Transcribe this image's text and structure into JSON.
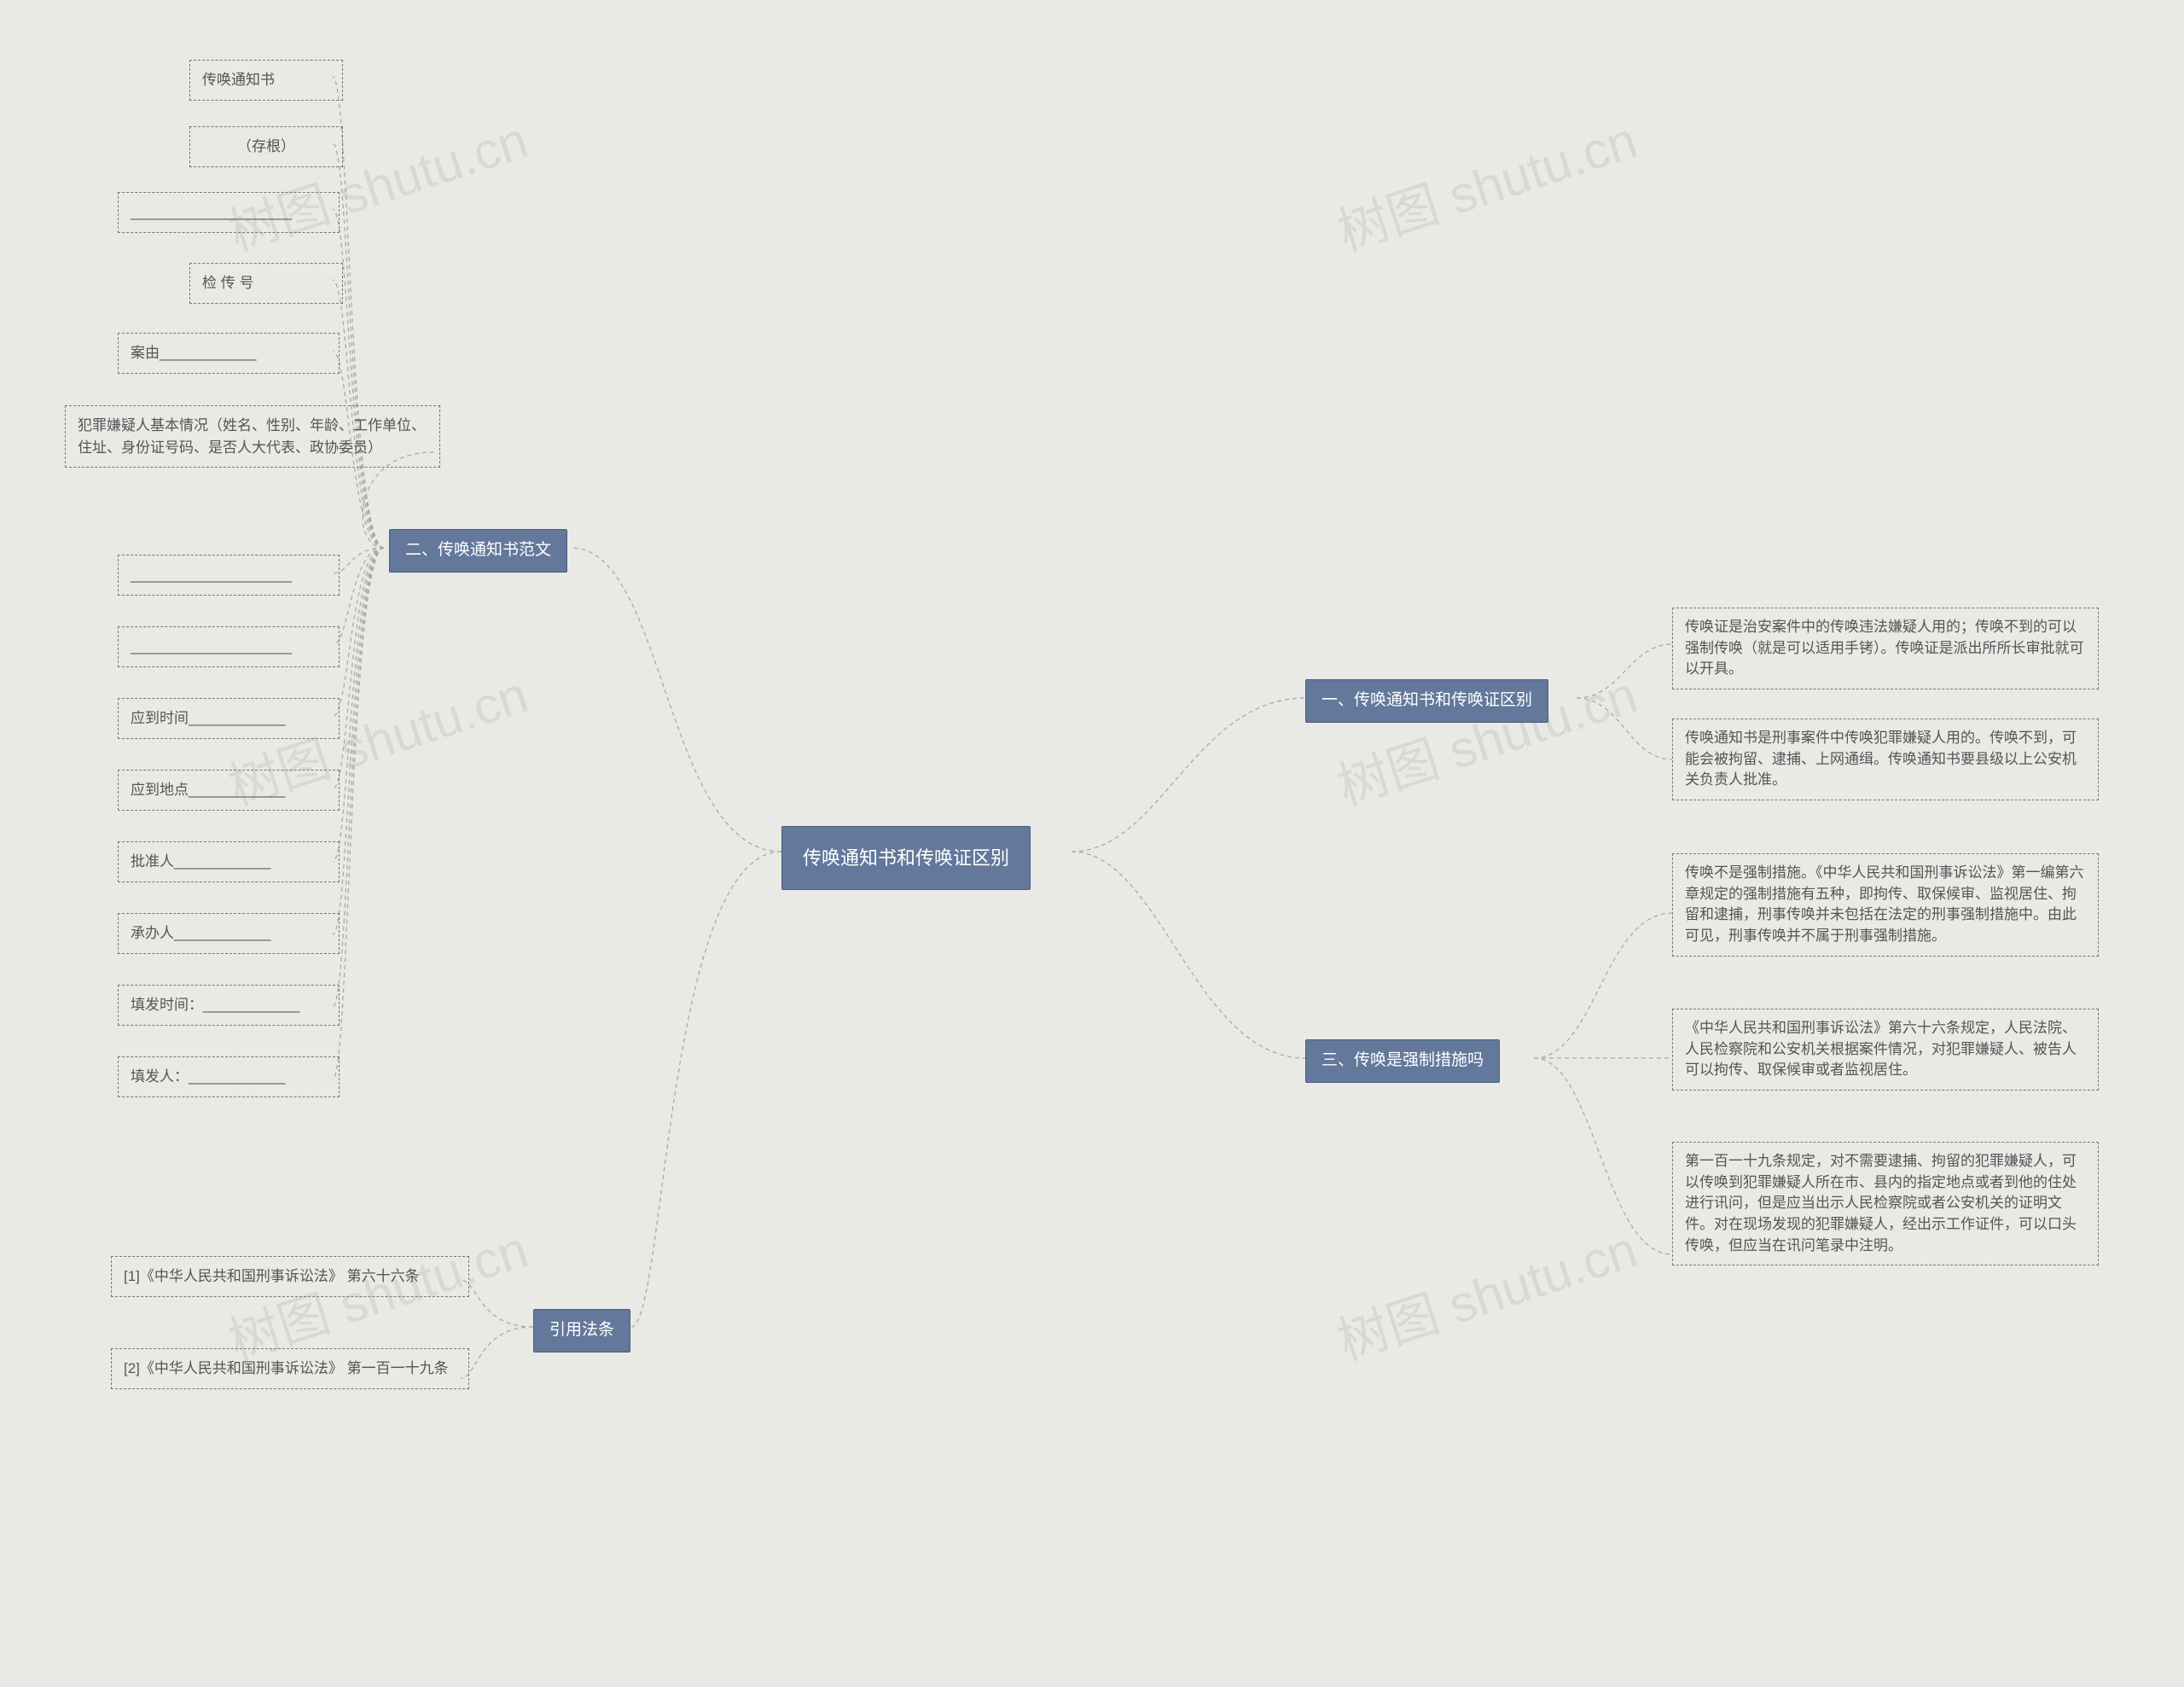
{
  "root": {
    "title": "传唤通知书和传唤证区别"
  },
  "branches": {
    "b1": {
      "title": "一、传唤通知书和传唤证区别",
      "children": {
        "c1": "传唤证是治安案件中的传唤违法嫌疑人用的；传唤不到的可以强制传唤（就是可以适用手铐）。传唤证是派出所所长审批就可以开具。",
        "c2": "传唤通知书是刑事案件中传唤犯罪嫌疑人用的。传唤不到，可能会被拘留、逮捕、上网通缉。传唤通知书要县级以上公安机关负责人批准。"
      }
    },
    "b2": {
      "title": "二、传唤通知书范文",
      "children": {
        "n1": "传唤通知书",
        "n2": "（存根）",
        "n3": "____________________",
        "n4": "检 传  号",
        "n5": "案由____________",
        "n6": "犯罪嫌疑人基本情况（姓名、性别、年龄、工作单位、住址、身份证号码、是否人大代表、政协委员）",
        "n7": "____________________",
        "n8": "____________________",
        "n9": "应到时间____________",
        "n10": "应到地点____________",
        "n11": "批准人____________",
        "n12": "承办人____________",
        "n13": "填发时间：____________",
        "n14": "填发人：____________"
      }
    },
    "b3": {
      "title": "三、传唤是强制措施吗",
      "children": {
        "c1": "传唤不是强制措施。《中华人民共和国刑事诉讼法》第一编第六章规定的强制措施有五种，即拘传、取保候审、监视居住、拘留和逮捕，刑事传唤并未包括在法定的刑事强制措施中。由此可见，刑事传唤并不属于刑事强制措施。",
        "c2": "《中华人民共和国刑事诉讼法》第六十六条规定，人民法院、人民检察院和公安机关根据案件情况，对犯罪嫌疑人、被告人可以拘传、取保候审或者监视居住。",
        "c3": "第一百一十九条规定，对不需要逮捕、拘留的犯罪嫌疑人，可以传唤到犯罪嫌疑人所在市、县内的指定地点或者到他的住处进行讯问，但是应当出示人民检察院或者公安机关的证明文件。对在现场发现的犯罪嫌疑人，经出示工作证件，可以口头传唤，但应当在讯问笔录中注明。"
      }
    },
    "ref": {
      "title": "引用法条",
      "children": {
        "r1": "[1]《中华人民共和国刑事诉讼法》 第六十六条",
        "r2": "[2]《中华人民共和国刑事诉讼法》 第一百一十九条"
      }
    }
  },
  "watermark_text": "树图 shutu.cn"
}
